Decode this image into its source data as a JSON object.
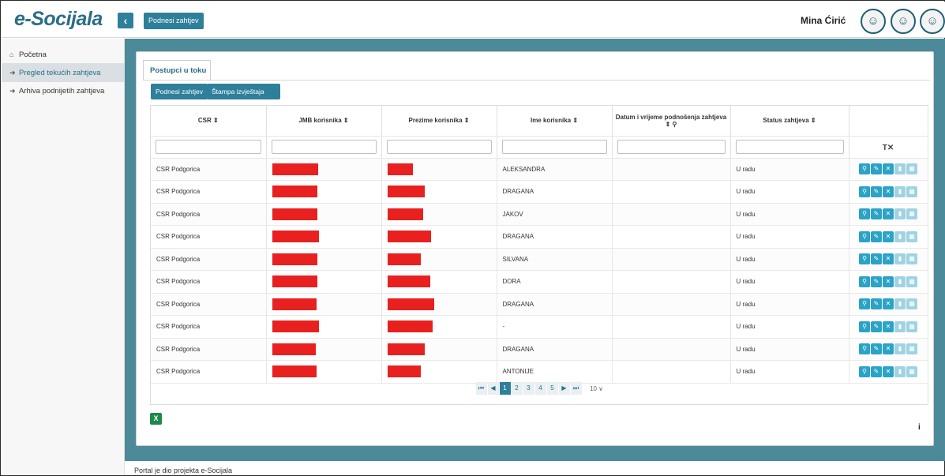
{
  "app": {
    "logo": "e-Socijala",
    "collapse_glyph": "‹"
  },
  "topbar": {
    "submit_request_label": "Podnesi zahtjev",
    "username": "Mina Ćirić"
  },
  "sidebar": {
    "items": [
      {
        "icon": "home-icon",
        "glyph": "⌂",
        "label": "Početna",
        "active": false
      },
      {
        "icon": "sign-in-icon",
        "glyph": "➜",
        "label": "Pregled tekućih zahtjeva",
        "active": true
      },
      {
        "icon": "sign-in-icon",
        "glyph": "➜",
        "label": "Arhiva podnijetih zahtjeva",
        "active": false
      }
    ]
  },
  "main": {
    "tab_label": "Postupci u toku",
    "toolbar": {
      "submit_label": "Podnesi zahtjev",
      "print_label": "Štampa izvještaja"
    },
    "columns": [
      "CSR ⇕",
      "JMB korisnika ⇕",
      "Prezime korisnika ⇕",
      "Ime korisnika ⇕",
      "Datum i vrijeme podnošenja zahtjeva ⇕ ⚲",
      "Status zahtjeva ⇕",
      ""
    ],
    "clear_filters_label": "T✕",
    "rows": [
      {
        "csr": "CSR Podgorica",
        "ime": "ALEKSANDRA",
        "datum": "",
        "status": "U radu"
      },
      {
        "csr": "CSR Podgorica",
        "ime": "DRAGANA",
        "datum": "",
        "status": "U radu"
      },
      {
        "csr": "CSR Podgorica",
        "ime": "JAKOV",
        "datum": "",
        "status": "U radu"
      },
      {
        "csr": "CSR Podgorica",
        "ime": "DRAGANA",
        "datum": "",
        "status": "U radu"
      },
      {
        "csr": "CSR Podgorica",
        "ime": "SILVANA",
        "datum": "",
        "status": "U radu"
      },
      {
        "csr": "CSR Podgorica",
        "ime": "DORA",
        "datum": "",
        "status": "U radu"
      },
      {
        "csr": "CSR Podgorica",
        "ime": "DRAGANA",
        "datum": "",
        "status": "U radu"
      },
      {
        "csr": "CSR Podgorica",
        "ime": "-",
        "datum": "",
        "status": "U radu"
      },
      {
        "csr": "CSR Podgorica",
        "ime": "DRAGANA",
        "datum": "",
        "status": "U radu"
      },
      {
        "csr": "CSR Podgorica",
        "ime": "ANTONIJE",
        "datum": "",
        "status": "U radu"
      }
    ],
    "row_actions": [
      "search-icon",
      "edit-icon",
      "delete-icon",
      "document-icon",
      "calendar-icon"
    ],
    "pager": {
      "first": "⏮",
      "prev": "◀",
      "pages": [
        "1",
        "2",
        "3",
        "4",
        "5"
      ],
      "current": "1",
      "next": "▶",
      "last": "⏭",
      "page_size": "10 ∨"
    }
  },
  "footer": {
    "text": "Portal je dio projekta e-Socijala"
  },
  "colors": {
    "primary": "#2e7f9a",
    "main_bg": "#4c8a9a",
    "redaction": "#e8201f",
    "action": "#2aa3c6"
  }
}
